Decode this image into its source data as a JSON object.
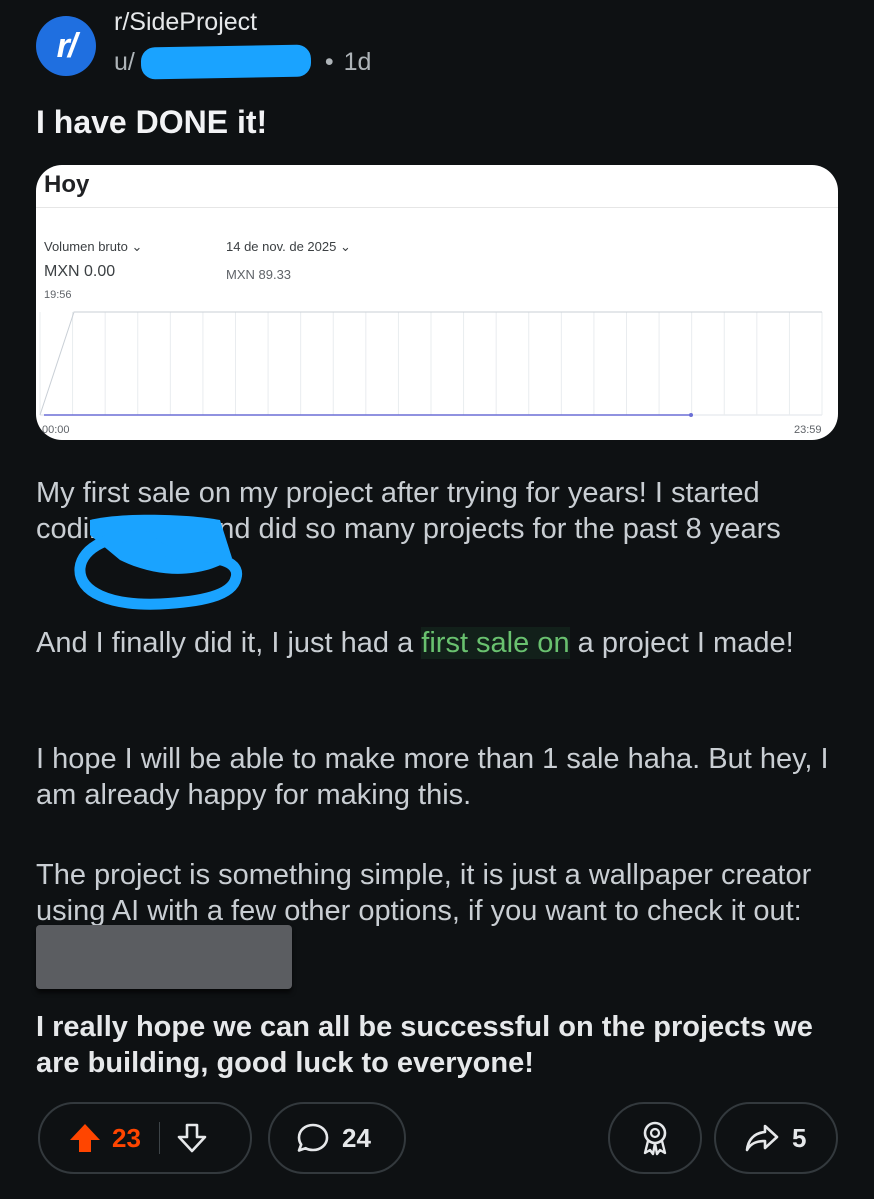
{
  "post": {
    "subreddit": "r/SideProject",
    "user_prefix": "u/",
    "separator": "•",
    "age": "1d",
    "title": "I have DONE it!"
  },
  "image": {
    "title": "Hoy",
    "metric1_label": "Volumen bruto",
    "metric1_value": "MXN 0.00",
    "metric1_time": "19:56",
    "metric2_label": "14 de nov. de 2025",
    "metric2_value": "MXN 89.33",
    "x_start": "00:00",
    "x_end": "23:59"
  },
  "body": {
    "p1": "My first sale on my project after trying for years! I started coding at 13 and did so many projects for the past 8 years",
    "p2_before": "And I finally did it, I just had a ",
    "p2_highlight": "first sale on",
    "p2_after": " a project I made!",
    "p3": "I hope I will be able to make more than 1 sale haha. But hey, I am already happy for making this.",
    "p4": "The project is something simple, it is just a wallpaper creator using AI with a few other options, if you want to check it out: ",
    "p5": "I really hope we can all be successful on the projects we are building, good luck to everyone!"
  },
  "actions": {
    "upvotes": "23",
    "comments": "24",
    "shares": "5"
  },
  "icons": {
    "upvote": "upvote-arrow-icon",
    "downvote": "downvote-arrow-icon",
    "comment": "comment-bubble-icon",
    "award": "award-icon",
    "share": "share-arrow-icon"
  },
  "colors": {
    "background": "#0e1113",
    "upvote_active": "#ff4500",
    "annotation_blue": "#1aa3ff",
    "highlight_green": "#69c16f"
  }
}
